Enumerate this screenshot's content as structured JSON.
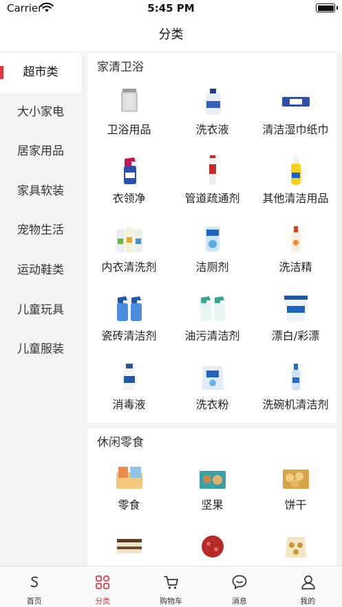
{
  "status_bar": {
    "carrier": "Carrier",
    "time": "5:45 PM",
    "battery_level": 1.0
  },
  "nav": {
    "title": "分类"
  },
  "sidebar": {
    "items": [
      {
        "label": "超市类",
        "active": true
      },
      {
        "label": "大小家电",
        "active": false
      },
      {
        "label": "居家用品",
        "active": false
      },
      {
        "label": "家具软装",
        "active": false
      },
      {
        "label": "宠物生活",
        "active": false
      },
      {
        "label": "运动鞋类",
        "active": false
      },
      {
        "label": "儿童玩具",
        "active": false
      },
      {
        "label": "儿童服装",
        "active": false
      }
    ]
  },
  "sections": [
    {
      "title": "家清卫浴",
      "items": [
        {
          "label": "卫浴用品",
          "icon": "bath-supplies-image"
        },
        {
          "label": "洗衣液",
          "icon": "laundry-liquid-image"
        },
        {
          "label": "清洁湿巾纸巾",
          "icon": "wet-wipes-image"
        },
        {
          "label": "衣领净",
          "icon": "collar-cleaner-image"
        },
        {
          "label": "管道疏通剂",
          "icon": "drain-cleaner-image"
        },
        {
          "label": "其他清洁用品",
          "icon": "other-cleaner-image"
        },
        {
          "label": "内衣清洗剂",
          "icon": "underwear-detergent-image"
        },
        {
          "label": "洁厕剂",
          "icon": "toilet-cleaner-image"
        },
        {
          "label": "洗洁精",
          "icon": "dish-soap-image"
        },
        {
          "label": "瓷砖清洁剂",
          "icon": "tile-cleaner-image"
        },
        {
          "label": "油污清洁剂",
          "icon": "degreaser-image"
        },
        {
          "label": "漂白/彩漂",
          "icon": "bleach-image"
        },
        {
          "label": "消毒液",
          "icon": "disinfectant-image"
        },
        {
          "label": "洗衣粉",
          "icon": "washing-powder-image"
        },
        {
          "label": "洗碗机清洁剂",
          "icon": "dishwasher-cleaner-image"
        }
      ]
    },
    {
      "title": "休闲零食",
      "items": [
        {
          "label": "零食",
          "icon": "snacks-image"
        },
        {
          "label": "坚果",
          "icon": "nuts-image"
        },
        {
          "label": "饼干",
          "icon": "biscuits-image"
        },
        {
          "label": "",
          "icon": "cake-image"
        },
        {
          "label": "",
          "icon": "candy-image"
        },
        {
          "label": "",
          "icon": "chocolate-box-image"
        }
      ]
    }
  ],
  "tab_bar": {
    "tabs": [
      {
        "label": "首页",
        "icon": "home-s-icon",
        "active": false
      },
      {
        "label": "分类",
        "icon": "category-grid-icon",
        "active": true
      },
      {
        "label": "购物车",
        "icon": "cart-icon",
        "active": false
      },
      {
        "label": "消息",
        "icon": "message-icon",
        "active": false
      },
      {
        "label": "我的",
        "icon": "profile-icon",
        "active": false
      }
    ]
  },
  "colors": {
    "accent": "#e0383e",
    "sidebar_bg": "#f4f4f4",
    "text": "#222222"
  }
}
